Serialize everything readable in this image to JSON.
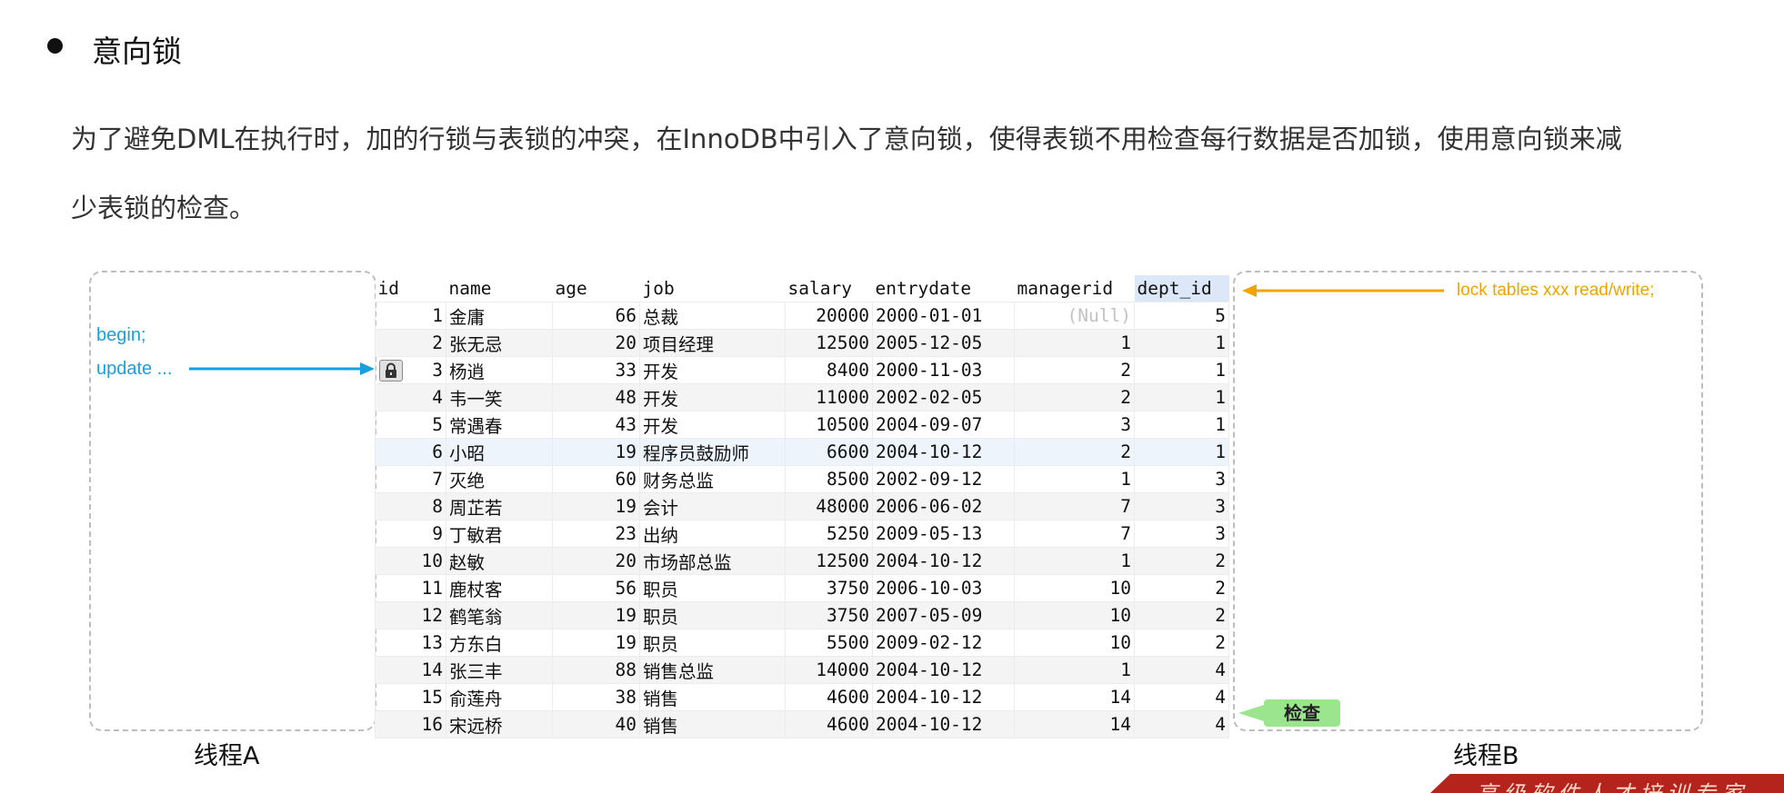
{
  "heading": "意向锁",
  "paragraph": {
    "line1": "为了避免DML在执行时，加的行锁与表锁的冲突，在InnoDB中引入了意向锁，使得表锁不用检查每行数据是否加锁，使用意向锁来减",
    "line2": "少表锁的检查。"
  },
  "threadA": {
    "label": "线程A",
    "code_begin": "begin;",
    "code_update": "update ..."
  },
  "threadB": {
    "label": "线程B",
    "command": "lock tables xxx read/write;",
    "badge": "检查"
  },
  "table": {
    "columns": [
      "id",
      "name",
      "age",
      "job",
      "salary",
      "entrydate",
      "managerid",
      "dept_id"
    ],
    "highlighted_column": "dept_id",
    "locked_row_id": "3",
    "rows": [
      {
        "id": "1",
        "name": "金庸",
        "age": "66",
        "job": "总裁",
        "salary": "20000",
        "entrydate": "2000-01-01",
        "managerid": "(Null)",
        "dept_id": "5"
      },
      {
        "id": "2",
        "name": "张无忌",
        "age": "20",
        "job": "项目经理",
        "salary": "12500",
        "entrydate": "2005-12-05",
        "managerid": "1",
        "dept_id": "1"
      },
      {
        "id": "3",
        "name": "杨逍",
        "age": "33",
        "job": "开发",
        "salary": "8400",
        "entrydate": "2000-11-03",
        "managerid": "2",
        "dept_id": "1"
      },
      {
        "id": "4",
        "name": "韦一笑",
        "age": "48",
        "job": "开发",
        "salary": "11000",
        "entrydate": "2002-02-05",
        "managerid": "2",
        "dept_id": "1"
      },
      {
        "id": "5",
        "name": "常遇春",
        "age": "43",
        "job": "开发",
        "salary": "10500",
        "entrydate": "2004-09-07",
        "managerid": "3",
        "dept_id": "1"
      },
      {
        "id": "6",
        "name": "小昭",
        "age": "19",
        "job": "程序员鼓励师",
        "salary": "6600",
        "entrydate": "2004-10-12",
        "managerid": "2",
        "dept_id": "1"
      },
      {
        "id": "7",
        "name": "灭绝",
        "age": "60",
        "job": "财务总监",
        "salary": "8500",
        "entrydate": "2002-09-12",
        "managerid": "1",
        "dept_id": "3"
      },
      {
        "id": "8",
        "name": "周芷若",
        "age": "19",
        "job": "会计",
        "salary": "48000",
        "entrydate": "2006-06-02",
        "managerid": "7",
        "dept_id": "3"
      },
      {
        "id": "9",
        "name": "丁敏君",
        "age": "23",
        "job": "出纳",
        "salary": "5250",
        "entrydate": "2009-05-13",
        "managerid": "7",
        "dept_id": "3"
      },
      {
        "id": "10",
        "name": "赵敏",
        "age": "20",
        "job": "市场部总监",
        "salary": "12500",
        "entrydate": "2004-10-12",
        "managerid": "1",
        "dept_id": "2"
      },
      {
        "id": "11",
        "name": "鹿杖客",
        "age": "56",
        "job": "职员",
        "salary": "3750",
        "entrydate": "2006-10-03",
        "managerid": "10",
        "dept_id": "2"
      },
      {
        "id": "12",
        "name": "鹤笔翁",
        "age": "19",
        "job": "职员",
        "salary": "3750",
        "entrydate": "2007-05-09",
        "managerid": "10",
        "dept_id": "2"
      },
      {
        "id": "13",
        "name": "方东白",
        "age": "19",
        "job": "职员",
        "salary": "5500",
        "entrydate": "2009-02-12",
        "managerid": "10",
        "dept_id": "2"
      },
      {
        "id": "14",
        "name": "张三丰",
        "age": "88",
        "job": "销售总监",
        "salary": "14000",
        "entrydate": "2004-10-12",
        "managerid": "1",
        "dept_id": "4"
      },
      {
        "id": "15",
        "name": "俞莲舟",
        "age": "38",
        "job": "销售",
        "salary": "4600",
        "entrydate": "2004-10-12",
        "managerid": "14",
        "dept_id": "4"
      },
      {
        "id": "16",
        "name": "宋远桥",
        "age": "40",
        "job": "销售",
        "salary": "4600",
        "entrydate": "2004-10-12",
        "managerid": "14",
        "dept_id": "4"
      }
    ]
  },
  "colors": {
    "arrow_a": "#1a9fdc",
    "arrow_b": "#f0a400",
    "badge": "#9be58e",
    "highlight_header": "#dce8f7"
  },
  "watermark": "高级软件人才培训专家"
}
